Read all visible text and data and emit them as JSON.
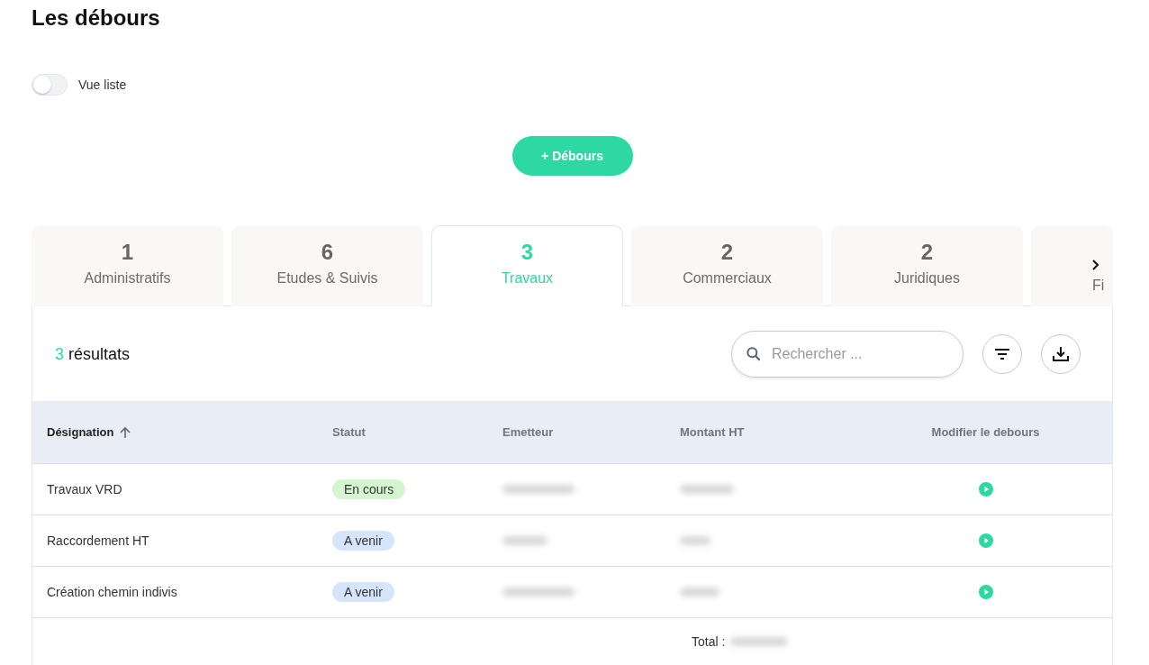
{
  "title": "Les débours",
  "view_toggle": {
    "label": "Vue liste",
    "on": false
  },
  "add_button": "+ Débours",
  "tabs": [
    {
      "count": "1",
      "label": "Administratifs",
      "selected": false
    },
    {
      "count": "6",
      "label": "Etudes & Suivis",
      "selected": false
    },
    {
      "count": "3",
      "label": "Travaux",
      "selected": true
    },
    {
      "count": "2",
      "label": "Commerciaux",
      "selected": false
    },
    {
      "count": "2",
      "label": "Juridiques",
      "selected": false
    },
    {
      "label": "Fi",
      "selected": false
    }
  ],
  "results": {
    "count": "3",
    "label": "résultats"
  },
  "search": {
    "placeholder": "Rechercher ..."
  },
  "table": {
    "columns": [
      {
        "label": "Désignation",
        "sorted": true
      },
      {
        "label": "Statut",
        "sorted": false
      },
      {
        "label": "Emetteur",
        "sorted": false
      },
      {
        "label": "Montant HT",
        "sorted": false
      },
      {
        "label": "Modifier le debours",
        "sorted": false
      }
    ],
    "rows": [
      {
        "designation": "Travaux VRD",
        "status": "En cours",
        "color": "#d4f5cf"
      },
      {
        "designation": "Raccordement HT",
        "status": "A venir",
        "color": "#d6e4fc"
      },
      {
        "designation": "Création chemin indivis",
        "status": "A venir",
        "color": "#d6e4fc"
      }
    ],
    "total_label": "Total :"
  }
}
